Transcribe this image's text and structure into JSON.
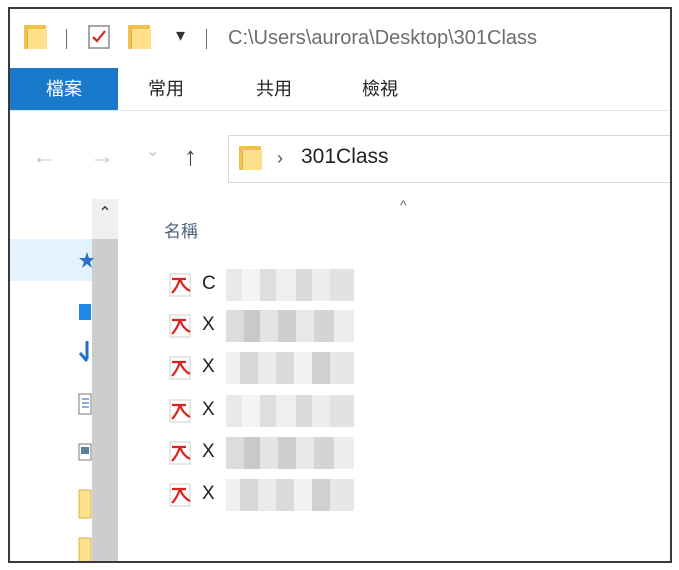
{
  "window": {
    "title_path": "C:\\Users\\aurora\\Desktop\\301Class",
    "quick_access_dropdown": "▾"
  },
  "ribbon": {
    "tabs": [
      {
        "label": "檔案",
        "active": true
      },
      {
        "label": "常用"
      },
      {
        "label": "共用"
      },
      {
        "label": "檢視"
      }
    ]
  },
  "nav": {
    "back": "←",
    "forward": "→",
    "recent": "⌄",
    "up": "↑"
  },
  "address": {
    "chevron": "›",
    "crumb": "301Class"
  },
  "content": {
    "column_name": "名稱",
    "sort_indicator": "^",
    "files": [
      {
        "prefix": "C"
      },
      {
        "prefix": "X"
      },
      {
        "prefix": "X"
      },
      {
        "prefix": "X"
      },
      {
        "prefix": "X"
      },
      {
        "prefix": "X"
      }
    ]
  },
  "sidebar": {
    "scroll_up": "⌃"
  },
  "colors": {
    "file_tab": "#1979ca",
    "folder": "#f3c04a",
    "pdf_red": "#d9231e"
  }
}
